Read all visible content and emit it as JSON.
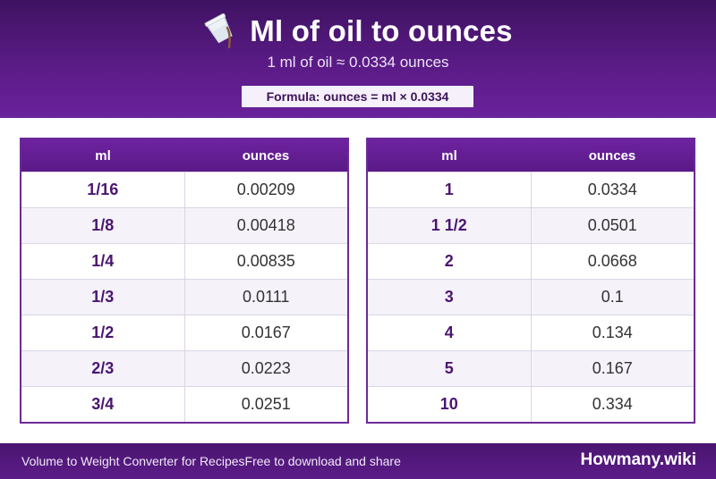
{
  "header": {
    "icon": "pouring-cup-icon",
    "title": "Ml of oil to ounces",
    "subtitle": "1 ml of oil ≈ 0.0334 ounces",
    "formula": "Formula: ounces = ml × 0.0334"
  },
  "tables": {
    "left": {
      "headers": [
        "ml",
        "ounces"
      ],
      "rows": [
        [
          "1/16",
          "0.00209"
        ],
        [
          "1/8",
          "0.00418"
        ],
        [
          "1/4",
          "0.00835"
        ],
        [
          "1/3",
          "0.0111"
        ],
        [
          "1/2",
          "0.0167"
        ],
        [
          "2/3",
          "0.0223"
        ],
        [
          "3/4",
          "0.0251"
        ]
      ]
    },
    "right": {
      "headers": [
        "ml",
        "ounces"
      ],
      "rows": [
        [
          "1",
          "0.0334"
        ],
        [
          "1 1/2",
          "0.0501"
        ],
        [
          "2",
          "0.0668"
        ],
        [
          "3",
          "0.1"
        ],
        [
          "4",
          "0.134"
        ],
        [
          "5",
          "0.167"
        ],
        [
          "10",
          "0.334"
        ]
      ]
    }
  },
  "footer": {
    "tagline": "Volume to Weight Converter for RecipesFree to download and share",
    "brand": "Howmany.wiki"
  },
  "colors": {
    "brand_purple": "#5a1b86",
    "header_dark": "#3f1261",
    "ml_text": "#4a1670",
    "row_alt": "#f5f2fa"
  }
}
